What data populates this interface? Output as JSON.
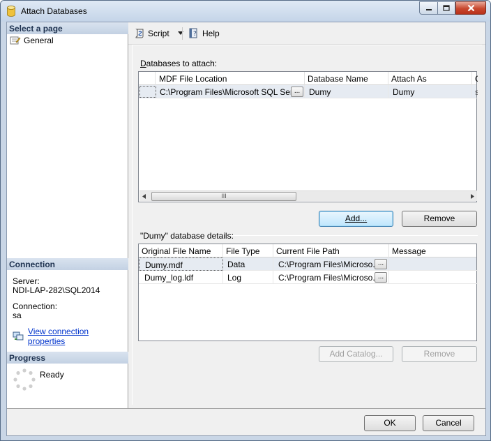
{
  "window": {
    "title": "Attach Databases",
    "icon": "database-cylinder-icon",
    "controls": {
      "minimize": "minimize-icon",
      "maximize": "maximize-icon",
      "close": "close-icon"
    }
  },
  "sidebar": {
    "select_page_header": "Select a page",
    "pages": [
      {
        "label": "General",
        "icon": "page-wrench-icon"
      }
    ],
    "connection_header": "Connection",
    "server_label": "Server:",
    "server_value": "NDI-LAP-282\\SQL2014",
    "connection_label": "Connection:",
    "connection_value": "sa",
    "view_props_link": "View connection properties",
    "progress_header": "Progress",
    "progress_status": "Ready"
  },
  "toolbar": {
    "script_label": "Script",
    "help_label": "Help"
  },
  "attach": {
    "group_label": "Databases to attach:",
    "columns": [
      "MDF File Location",
      "Database Name",
      "Attach As",
      "O"
    ],
    "rows": [
      {
        "mdf": "C:\\Program Files\\Microsoft SQL Ser...",
        "db_name": "Dumy",
        "attach_as": "Dumy",
        "owner": "s"
      }
    ],
    "ellipsis": "...",
    "scroll_thumb": "III",
    "add_button": "Add...",
    "remove_button": "Remove"
  },
  "details": {
    "group_label": "\"Dumy\" database details:",
    "columns": [
      "Original File Name",
      "File Type",
      "Current File Path",
      "Message"
    ],
    "rows": [
      {
        "name": "Dumy.mdf",
        "type": "Data",
        "path": "C:\\Program Files\\Microso...",
        "message": ""
      },
      {
        "name": "Dumy_log.ldf",
        "type": "Log",
        "path": "C:\\Program Files\\Microso...",
        "message": ""
      }
    ],
    "ellipsis": "...",
    "add_catalog_button": "Add Catalog...",
    "remove_button": "Remove"
  },
  "footer": {
    "ok_button": "OK",
    "cancel_button": "Cancel"
  }
}
